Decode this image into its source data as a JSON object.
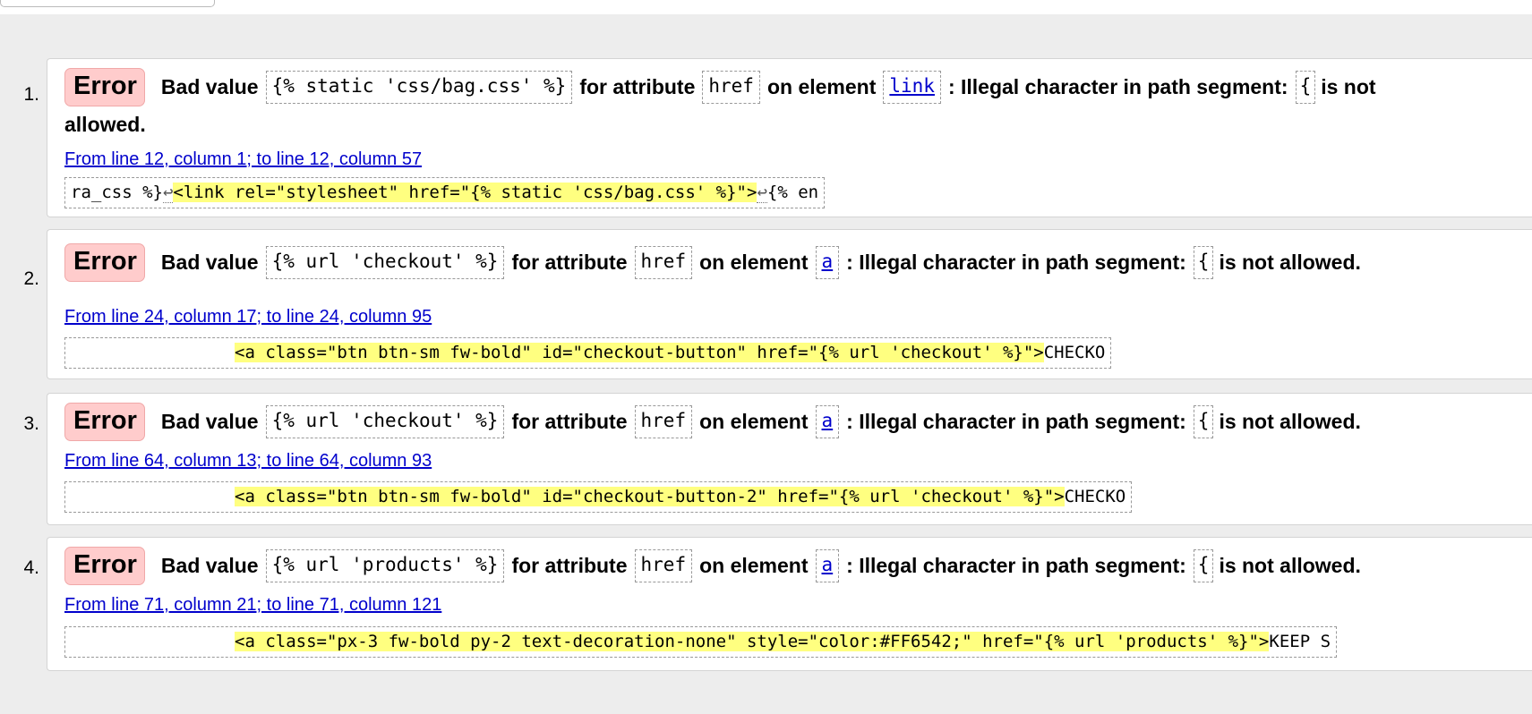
{
  "messages": [
    {
      "num": "1.",
      "badge": "Error",
      "prefix": "Bad value",
      "value": "{% static 'css/bag.css' %}",
      "mid1": "for attribute",
      "attr": "href",
      "mid2": "on element",
      "element": "link",
      "reason": ": Illegal character in path segment:",
      "char": "{",
      "suffix": "is not",
      "suffix_wrap": "allowed.",
      "location": "From line 12, column 1; to line 12, column 57",
      "extract_pre": "ra_css %}",
      "extract_lf1": "↩",
      "extract_hl": "<link rel=\"stylesheet\" href=\"{% static 'css/bag.css' %}\">",
      "extract_lf2": "↩",
      "extract_post": "{% en"
    },
    {
      "num": "2.",
      "badge": "Error",
      "prefix": "Bad value",
      "value": "{% url 'checkout' %}",
      "mid1": "for attribute",
      "attr": "href",
      "mid2": "on element",
      "element": "a",
      "reason": ": Illegal character in path segment:",
      "char": "{",
      "suffix": "is not allowed.",
      "location": "From line 24, column 17; to line 24, column 95",
      "extract_pre": "                ",
      "extract_hl": "<a class=\"btn btn-sm fw-bold\" id=\"checkout-button\" href=\"{% url 'checkout' %}\">",
      "extract_post": "CHECKO"
    },
    {
      "num": "3.",
      "badge": "Error",
      "prefix": "Bad value",
      "value": "{% url 'checkout' %}",
      "mid1": "for attribute",
      "attr": "href",
      "mid2": "on element",
      "element": "a",
      "reason": ": Illegal character in path segment:",
      "char": "{",
      "suffix": "is not allowed.",
      "location": "From line 64, column 13; to line 64, column 93",
      "extract_pre": "                ",
      "extract_hl": "<a class=\"btn btn-sm fw-bold\" id=\"checkout-button-2\" href=\"{% url 'checkout' %}\">",
      "extract_post": "CHECKO"
    },
    {
      "num": "4.",
      "badge": "Error",
      "prefix": "Bad value",
      "value": "{% url 'products' %}",
      "mid1": "for attribute",
      "attr": "href",
      "mid2": "on element",
      "element": "a",
      "reason": ": Illegal character in path segment:",
      "char": "{",
      "suffix": "is not allowed.",
      "location": "From line 71, column 21; to line 71, column 121",
      "extract_pre": "                ",
      "extract_hl": "<a class=\"px-3 fw-bold py-2 text-decoration-none\" style=\"color:#FF6542;\" href=\"{% url 'products' %}\">",
      "extract_post": "KEEP S"
    }
  ]
}
